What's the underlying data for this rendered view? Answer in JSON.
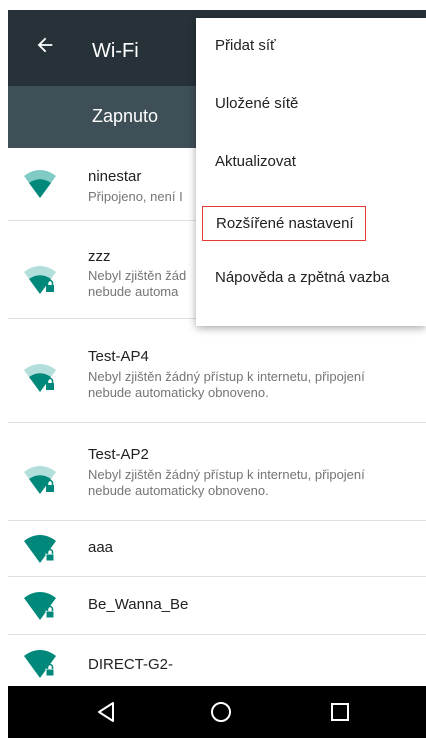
{
  "app": {
    "title": "Wi-Fi",
    "switch_label": "Zapnuto"
  },
  "colors": {
    "app_bar": "#263238",
    "switch_bar": "#3e4f57",
    "wifi_icon": "#00897b",
    "wifi_icon_weak": "#80cbc4",
    "highlight_border": "#e53935"
  },
  "menu": {
    "items": [
      {
        "label": "Přidat síť"
      },
      {
        "label": "Uložené sítě"
      },
      {
        "label": "Aktualizovat"
      },
      {
        "label": "Rozšířené nastavení"
      },
      {
        "label": "Nápověda a zpětná vazba"
      }
    ]
  },
  "networks": [
    {
      "ssid": "ninestar",
      "status": "Připojeno, není I",
      "locked": false,
      "signal": "strong"
    },
    {
      "ssid": "zzz",
      "status": "Nebyl zjištěn žád\nnebude automa",
      "locked": true,
      "signal": "weak"
    },
    {
      "ssid": "Test-AP4",
      "status": "Nebyl zjištěn žádný přístup k internetu, připojení nebude automaticky obnoveno.",
      "locked": true,
      "signal": "weak"
    },
    {
      "ssid": "Test-AP2",
      "status": "Nebyl zjištěn žádný přístup k internetu, připojení nebude automaticky obnoveno.",
      "locked": true,
      "signal": "weak"
    },
    {
      "ssid": "aaa",
      "status": "",
      "locked": true,
      "signal": "strong"
    },
    {
      "ssid": "Be_Wanna_Be",
      "status": "",
      "locked": true,
      "signal": "strong"
    },
    {
      "ssid": "DIRECT-G2-",
      "status": "",
      "locked": true,
      "signal": "strong"
    }
  ],
  "navbar": {
    "buttons": [
      "back-icon",
      "home-icon",
      "recents-icon"
    ]
  }
}
